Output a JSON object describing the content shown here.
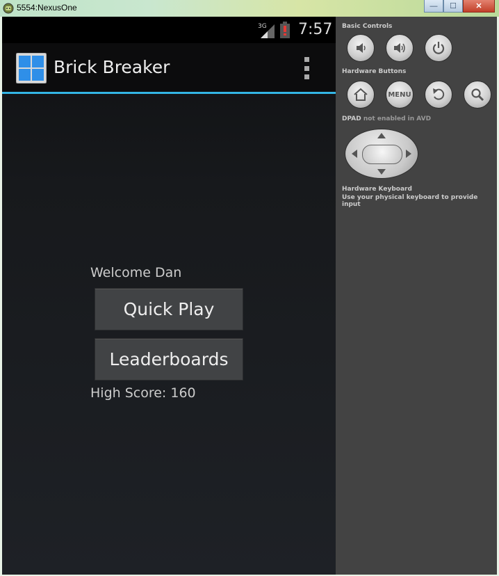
{
  "window": {
    "title": "5554:NexusOne",
    "min_glyph": "—",
    "max_glyph": "☐",
    "close_glyph": "✕"
  },
  "status_bar": {
    "network": "3G",
    "time": "7:57",
    "battery_icon": "battery-low-icon"
  },
  "action_bar": {
    "title": "Brick Breaker",
    "accent_color": "#33b5e5",
    "menu_icon": "overflow-menu-icon"
  },
  "main": {
    "welcome": "Welcome Dan",
    "quick_play": "Quick Play",
    "leaderboards": "Leaderboards",
    "high_score": "High Score: 160"
  },
  "controls": {
    "basic_label": "Basic Controls",
    "basic_buttons": [
      "volume-down-icon",
      "volume-up-icon",
      "power-icon"
    ],
    "hardware_label": "Hardware Buttons",
    "hardware_buttons": [
      "home-icon",
      "menu",
      "back-icon",
      "search-icon"
    ],
    "menu_label": "MENU",
    "dpad_label": "DPAD",
    "dpad_note": "not enabled in AVD",
    "keyboard_label": "Hardware Keyboard",
    "keyboard_note": "Use your physical keyboard to provide input"
  }
}
